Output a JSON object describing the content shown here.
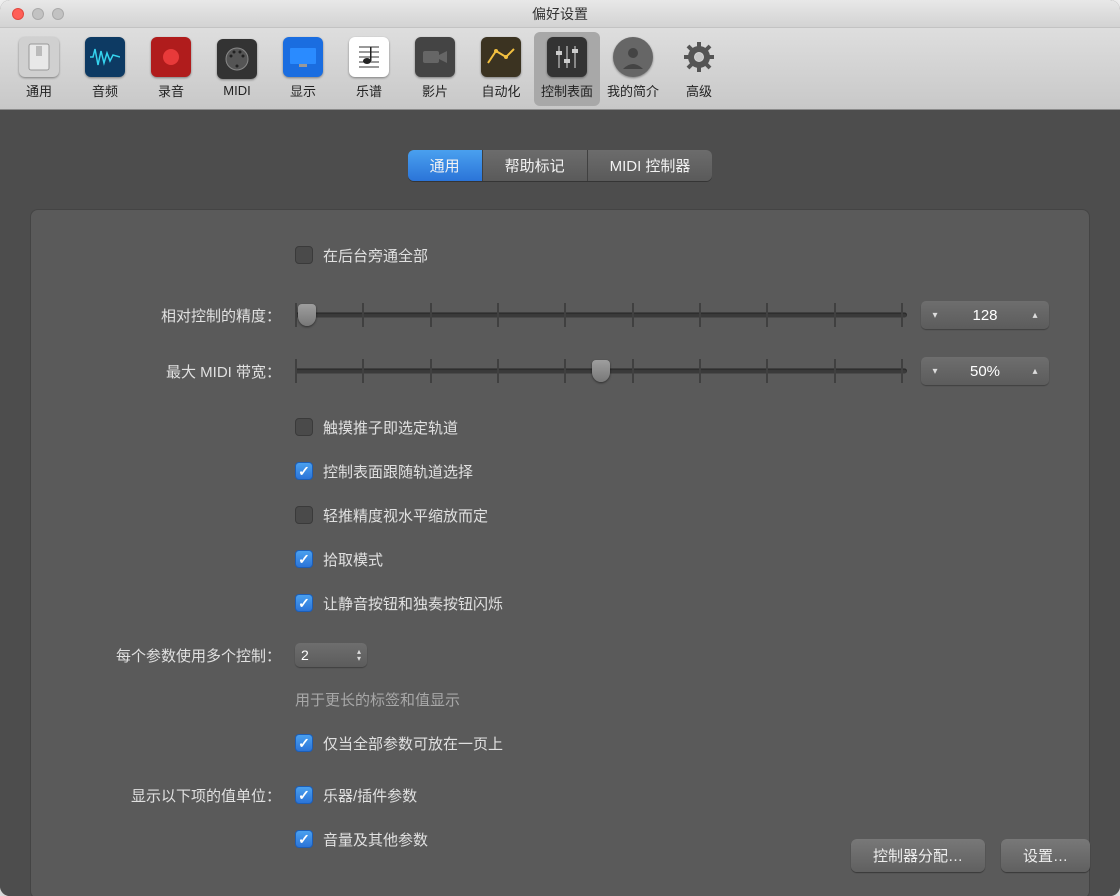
{
  "window": {
    "title": "偏好设置"
  },
  "toolbar": {
    "items": [
      {
        "label": "通用"
      },
      {
        "label": "音频"
      },
      {
        "label": "录音"
      },
      {
        "label": "MIDI"
      },
      {
        "label": "显示"
      },
      {
        "label": "乐谱"
      },
      {
        "label": "影片"
      },
      {
        "label": "自动化"
      },
      {
        "label": "控制表面"
      },
      {
        "label": "我的简介"
      },
      {
        "label": "高级"
      }
    ],
    "active_index": 8
  },
  "tabs": {
    "items": [
      "通用",
      "帮助标记",
      "MIDI 控制器"
    ],
    "active_index": 0
  },
  "form": {
    "bypass_all_bg": "在后台旁通全部",
    "resolution_label": "相对控制的精度：",
    "resolution_value": "128",
    "bandwidth_label": "最大 MIDI 带宽：",
    "bandwidth_value": "50%",
    "touch_fader": "触摸推子即选定轨道",
    "follows_track": "控制表面跟随轨道选择",
    "nudge_zoom": "轻推精度视水平缩放而定",
    "pickup_mode": "拾取模式",
    "flash_mute_solo": "让静音按钮和独奏按钮闪烁",
    "multi_ctrl_label": "每个参数使用多个控制：",
    "multi_ctrl_value": "2",
    "multi_ctrl_hint": "用于更长的标签和值显示",
    "only_one_page": "仅当全部参数可放在一页上",
    "value_units_label": "显示以下项的值单位：",
    "instr_plugin": "乐器/插件参数",
    "vol_other": "音量及其他参数"
  },
  "footer": {
    "assignments": "控制器分配…",
    "setup": "设置…"
  }
}
